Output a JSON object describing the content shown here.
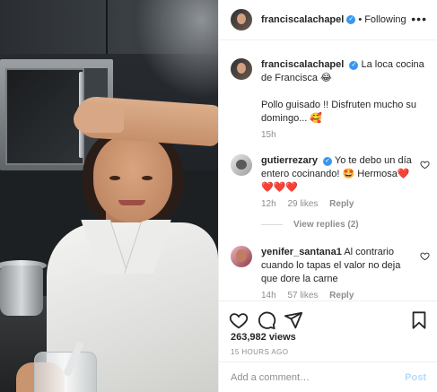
{
  "header": {
    "username": "franciscalachapel",
    "dot": "•",
    "follow_status": "Following",
    "more": "•••"
  },
  "caption": {
    "username": "franciscalachapel",
    "line1": "La loca cocina de Francisca 😂",
    "line2": "Pollo guisado !! Disfruten mucho su domingo... 🥰",
    "time": "15h"
  },
  "comments": [
    {
      "username": "gutierrezary",
      "text": "Yo te debo un día entero cocinando! 🤩 Hermosa❤️❤️❤️❤️",
      "time": "12h",
      "likes": "29 likes",
      "reply": "Reply",
      "view_replies": "View replies (2)"
    },
    {
      "username": "yenifer_santana1",
      "text": "Al contrario cuando lo tapas el valor no deja que dore la carne",
      "time": "14h",
      "likes": "57 likes",
      "reply": "Reply"
    }
  ],
  "actions": {
    "views": "263,982 views",
    "ago": "15 HOURS AGO"
  },
  "add_comment": {
    "placeholder": "Add a comment…",
    "post_label": "Post"
  },
  "colors": {
    "verified": "#3897f0",
    "post_disabled": "#b3dbff",
    "muted_text": "#8e8e8e"
  }
}
